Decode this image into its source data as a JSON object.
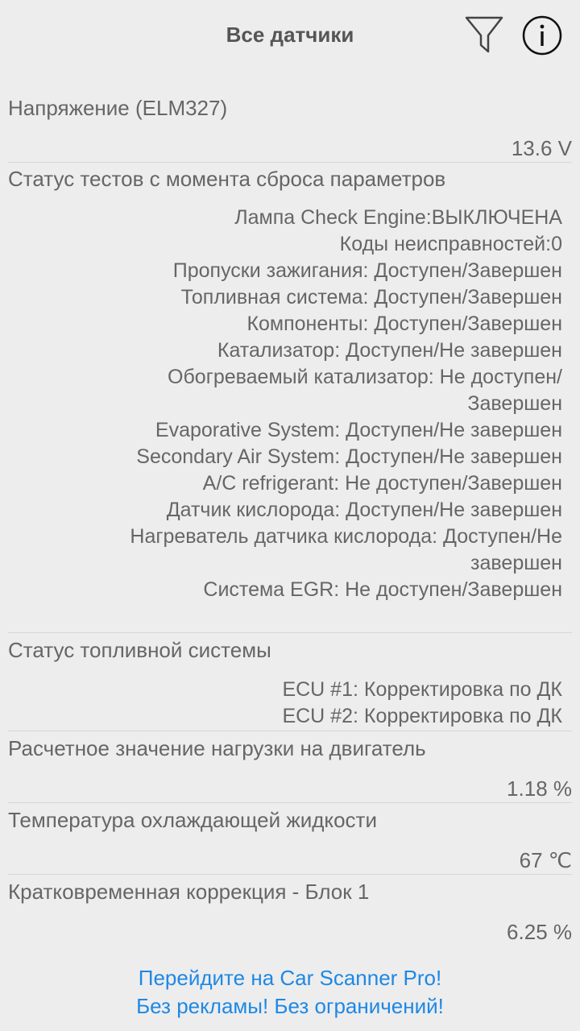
{
  "header": {
    "title": "Все датчики",
    "filter_icon": "filter-icon",
    "info_icon": "info-icon"
  },
  "sensors": {
    "voltage": {
      "name": "Напряжение (ELM327)",
      "value": "13.6  V"
    },
    "monitor_status": {
      "name": "Статус тестов с момента сброса параметров",
      "lines": [
        "Лампа Check Engine:ВЫКЛЮЧЕНА",
        "Коды неисправностей:0",
        "Пропуски зажигания: Доступен/Завершен",
        "Топливная система: Доступен/Завершен",
        "Компоненты: Доступен/Завершен",
        "Катализатор: Доступен/Не завершен",
        "Обогреваемый катализатор: Не доступен/",
        "Завершен",
        "Evaporative System: Доступен/Не завершен",
        "Secondary Air System: Доступен/Не завершен",
        "A/C refrigerant: Не доступен/Завершен",
        "Датчик кислорода: Доступен/Не завершен",
        "Нагреватель датчика кислорода: Доступен/Не",
        "завершен",
        "Система EGR: Не доступен/Завершен"
      ]
    },
    "fuel_status": {
      "name": "Статус топливной системы",
      "lines": [
        "ECU #1: Корректировка по ДК",
        "ECU #2: Корректировка по ДК"
      ]
    },
    "engine_load": {
      "name": "Расчетное значение нагрузки на двигатель",
      "value": "1.18  %"
    },
    "coolant_temp": {
      "name": "Температура охлаждающей жидкости",
      "value": "67  ℃"
    },
    "stft": {
      "name": "Кратковременная коррекция - Блок 1",
      "value": "6.25  %"
    }
  },
  "promo": {
    "line1": "Перейдите на Car Scanner Pro!",
    "line2": "Без рекламы! Без ограничений!"
  },
  "colors": {
    "background": "#ededed",
    "text": "#666666",
    "link": "#1e88e5",
    "divider": "#d6d6d6"
  }
}
